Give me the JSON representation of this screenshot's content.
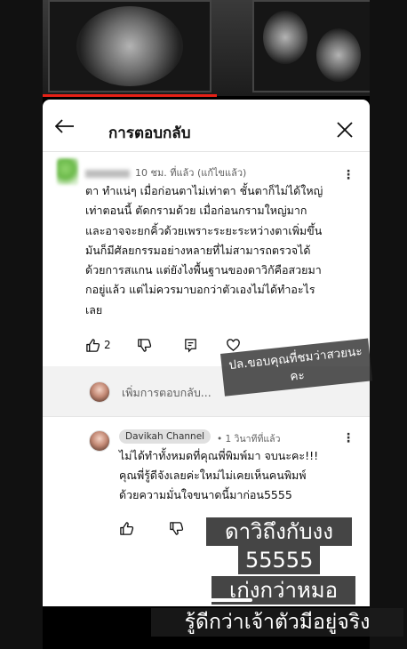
{
  "header": {
    "title": "การตอบกลับ"
  },
  "comment": {
    "time": "10 ชม. ที่แล้ว (แก้ไขแล้ว)",
    "lines": [
      "ตา ทำแน่ๆ เมื่อก่อนตาไม่เท่าตา ชั้นตาก็ไม่ได้ใหญ่",
      "เท่าตอนนี้ ตัดกรามด้วย เมื่อก่อนกรามใหญ่มาก",
      "และอาจจะยกคิ้วด้วยเพราะระยะระหว่างตาเพิ่มขึ้น",
      "มันก็มีศัลยกรรมอย่างหลายที่ไม่สามารถตรวจได้",
      "ด้วยการสแกน แต่ยังไงพื้นฐานของดาวิกัคือสวยมา",
      "กอยู่แล้ว แต่ไม่ควรมาบอกว่าตัวเองไม่ได้ทำอะไร",
      "เลย"
    ],
    "like_count": "2"
  },
  "add_reply": {
    "placeholder": "เพิ่มการตอบกลับ..."
  },
  "reply": {
    "channel": "Davikah Channel",
    "time": "• 1 วินาทีที่แล้ว",
    "lines": [
      "ไม่ได้ทำทั้งหมดที่คุณพี่พิมพ์มา จบนะคะ!!!",
      "คุณพี่รู้ดีจังเลยค่ะใหม่ไม่เคยเห็นคนพิมพ์",
      "ด้วยความมั่นใจขนาดนี้มาก่อน5555"
    ]
  },
  "stickers": {
    "thanks": [
      "ปล.ขอบคุณที่ชมว่าสวยนะ",
      "คะ"
    ],
    "big": [
      "ดาวิถึงกับงง",
      "55555",
      "เก่งกว่าหมอ",
      "รู้ดีกว่าเจ้าตัวมีอยู่จริง"
    ]
  },
  "icons": {
    "back": "arrow-left-icon",
    "close": "close-icon",
    "like": "thumbs-up-icon",
    "dislike": "thumbs-down-icon",
    "reply": "comment-icon",
    "heart": "heart-icon",
    "more": "more-vertical-icon"
  },
  "colors": {
    "progress": "#e62117",
    "panel": "#ffffff",
    "sticker_bg": "#1c1c1c"
  }
}
